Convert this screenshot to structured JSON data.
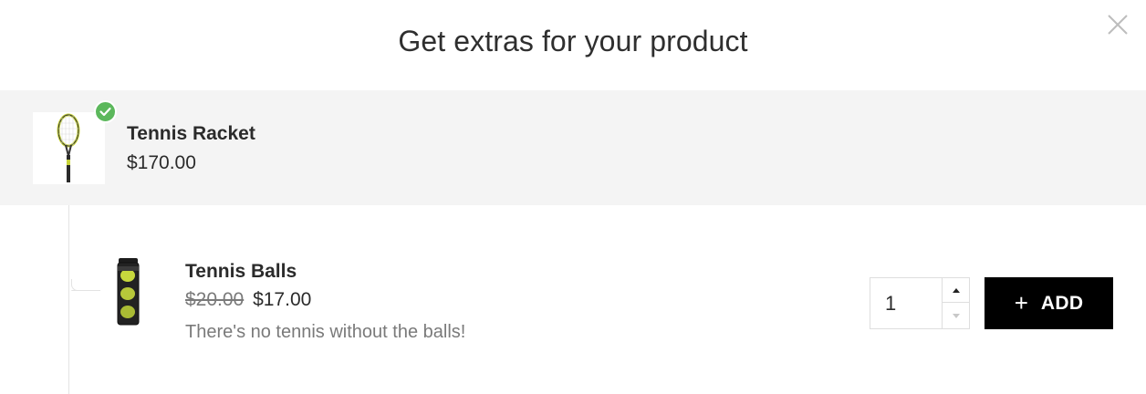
{
  "modal": {
    "title": "Get extras for your product",
    "close_icon": "close-icon"
  },
  "main_product": {
    "name": "Tennis Racket",
    "price": "$170.00",
    "image_icon": "tennis-racket-image",
    "selected_badge_icon": "check-circle-icon",
    "badge_color": "#5cb85c"
  },
  "addon": {
    "name": "Tennis Balls",
    "old_price": "$20.00",
    "new_price": "$17.00",
    "description": "There's no tennis without the balls!",
    "image_icon": "tennis-balls-can-image",
    "quantity": "1",
    "add_button_label": "ADD",
    "add_button_icon": "plus-icon",
    "add_button_color": "#000000"
  }
}
